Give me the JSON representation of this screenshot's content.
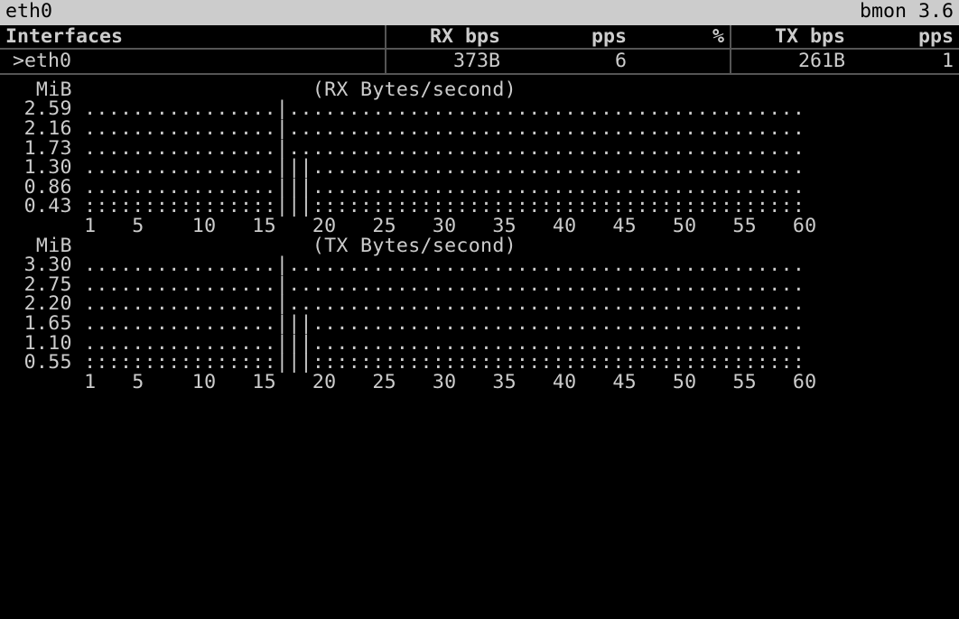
{
  "title_bar": {
    "left": " eth0",
    "right": "bmon 3.6 "
  },
  "table": {
    "headers": {
      "iface": "Interfaces",
      "rx_bps": "RX bps",
      "pps1": "pps",
      "pct": "%",
      "tx_bps": "TX bps",
      "pps2": "pps"
    },
    "row": {
      "cursor": ">",
      "iface": "eth0",
      "rx_bps": "373B",
      "pps1": "6",
      "pct": "",
      "tx_bps": "261B",
      "pps2": "1"
    }
  },
  "chart_data": [
    {
      "type": "line",
      "title": "(RX Bytes/second)",
      "ylabel": "MiB",
      "y_ticks": [
        "2.59",
        "2.16",
        "1.73",
        "1.30",
        "0.86",
        "0.43"
      ],
      "x_ticks": [
        "1",
        "5",
        "10",
        "15",
        "20",
        "25",
        "30",
        "35",
        "40",
        "45",
        "50",
        "55",
        "60"
      ],
      "columns": 60,
      "series": [
        {
          "name": "RX",
          "bars": {
            "17": 6,
            "18": 3,
            "19": 3
          }
        }
      ],
      "baseline_double": true
    },
    {
      "type": "line",
      "title": "(TX Bytes/second)",
      "ylabel": "MiB",
      "y_ticks": [
        "3.30",
        "2.75",
        "2.20",
        "1.65",
        "1.10",
        "0.55"
      ],
      "x_ticks": [
        "1",
        "5",
        "10",
        "15",
        "20",
        "25",
        "30",
        "35",
        "40",
        "45",
        "50",
        "55",
        "60"
      ],
      "columns": 60,
      "series": [
        {
          "name": "TX",
          "bars": {
            "17": 6,
            "18": 3,
            "19": 3
          }
        }
      ],
      "baseline_double": true
    }
  ]
}
